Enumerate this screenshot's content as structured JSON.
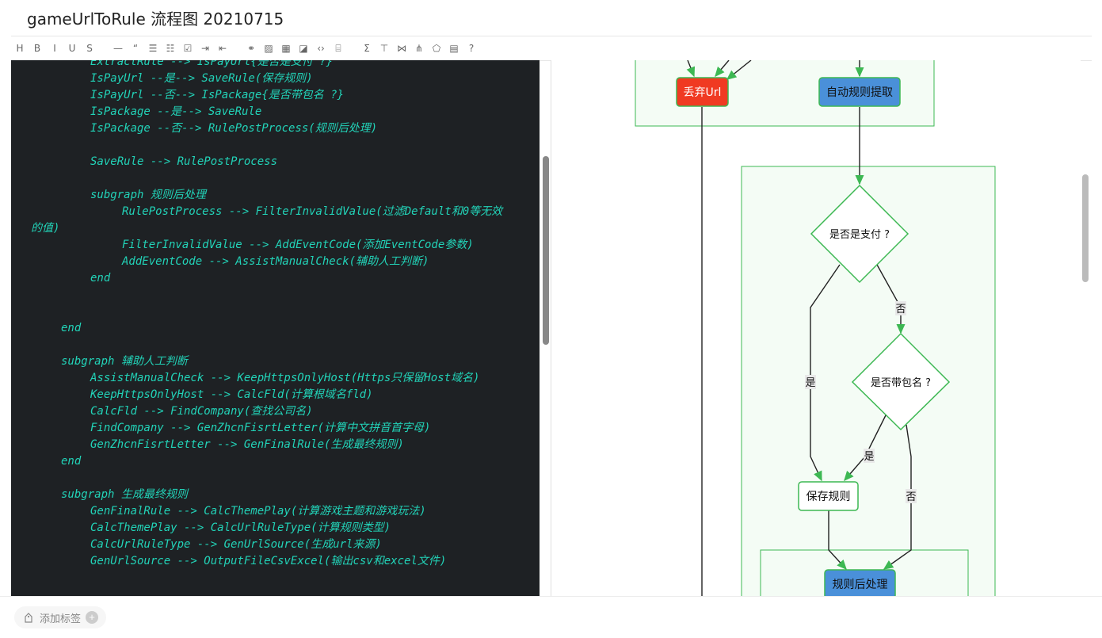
{
  "title": "gameUrlToRule 流程图 20210715",
  "toolbar": [
    {
      "name": "heading-button",
      "glyph": "H"
    },
    {
      "name": "bold-button",
      "glyph": "B"
    },
    {
      "name": "italic-button",
      "glyph": "I"
    },
    {
      "name": "underline-button",
      "glyph": "U"
    },
    {
      "name": "strikethrough-button",
      "glyph": "S"
    },
    {
      "gap": true
    },
    {
      "name": "horizontal-rule-button",
      "glyph": "—"
    },
    {
      "name": "quote-button",
      "glyph": "“"
    },
    {
      "name": "bullet-list-button",
      "glyph": "☰"
    },
    {
      "name": "numbered-list-button",
      "glyph": "☷"
    },
    {
      "name": "checklist-button",
      "glyph": "☑"
    },
    {
      "name": "indent-button",
      "glyph": "⇥"
    },
    {
      "name": "outdent-button",
      "glyph": "⇤"
    },
    {
      "gap": true
    },
    {
      "name": "link-button",
      "glyph": "⚭"
    },
    {
      "name": "image-button",
      "glyph": "▨"
    },
    {
      "name": "table-button",
      "glyph": "▦"
    },
    {
      "name": "chart-button",
      "glyph": "◪"
    },
    {
      "name": "code-button",
      "glyph": "‹›"
    },
    {
      "name": "code-block-button",
      "glyph": "⌸"
    },
    {
      "gap": true
    },
    {
      "name": "formula-button",
      "glyph": "Σ"
    },
    {
      "name": "flowchart-button",
      "glyph": "⊤"
    },
    {
      "name": "sequence-button",
      "glyph": "⋈"
    },
    {
      "name": "gantt-button",
      "glyph": "⋔"
    },
    {
      "name": "mindmap-button",
      "glyph": "⬠"
    },
    {
      "name": "toc-button",
      "glyph": "▤"
    },
    {
      "name": "help-button",
      "glyph": "?"
    }
  ],
  "code_lines": [
    {
      "indent": 100,
      "text": "ExtractRule --> IsPayUrl{是否是支付 ?}"
    },
    {
      "indent": 100,
      "text": "IsPayUrl --是--> SaveRule(保存规则)"
    },
    {
      "indent": 100,
      "text": "IsPayUrl --否--> IsPackage{是否带包名 ?}"
    },
    {
      "indent": 100,
      "text": "IsPackage --是--> SaveRule"
    },
    {
      "indent": 100,
      "text": "IsPackage --否--> RulePostProcess(规则后处理)"
    },
    {
      "indent": 0,
      "text": ""
    },
    {
      "indent": 100,
      "text": "SaveRule --> RulePostProcess"
    },
    {
      "indent": 0,
      "text": ""
    },
    {
      "indent": 100,
      "text": "subgraph 规则后处理"
    },
    {
      "indent": 140,
      "text": "RulePostProcess --> FilterInvalidValue(过滤Default和0等无效"
    },
    {
      "indent": 25,
      "text": "的值)"
    },
    {
      "indent": 140,
      "text": "FilterInvalidValue --> AddEventCode(添加EventCode参数)"
    },
    {
      "indent": 140,
      "text": "AddEventCode --> AssistManualCheck(辅助人工判断)"
    },
    {
      "indent": 100,
      "text": "end"
    },
    {
      "indent": 0,
      "text": ""
    },
    {
      "indent": 0,
      "text": ""
    },
    {
      "indent": 63,
      "text": "end"
    },
    {
      "indent": 0,
      "text": ""
    },
    {
      "indent": 63,
      "text": "subgraph 辅助人工判断"
    },
    {
      "indent": 100,
      "text": "AssistManualCheck --> KeepHttpsOnlyHost(Https只保留Host域名)"
    },
    {
      "indent": 100,
      "text": "KeepHttpsOnlyHost --> CalcFld(计算根域名fld)"
    },
    {
      "indent": 100,
      "text": "CalcFld --> FindCompany(查找公司名)"
    },
    {
      "indent": 100,
      "text": "FindCompany --> GenZhcnFisrtLetter(计算中文拼音首字母)"
    },
    {
      "indent": 100,
      "text": "GenZhcnFisrtLetter --> GenFinalRule(生成最终规则)"
    },
    {
      "indent": 63,
      "text": "end"
    },
    {
      "indent": 0,
      "text": ""
    },
    {
      "indent": 63,
      "text": "subgraph 生成最终规则"
    },
    {
      "indent": 100,
      "text": "GenFinalRule --> CalcThemePlay(计算游戏主题和游戏玩法)"
    },
    {
      "indent": 100,
      "text": "CalcThemePlay --> CalcUrlRuleType(计算规则类型)"
    },
    {
      "indent": 100,
      "text": "CalcUrlRuleType --> GenUrlSource(生成url来源)"
    },
    {
      "indent": 100,
      "text": "GenUrlSource --> OutputFileCsvExcel(输出csv和excel文件)"
    }
  ],
  "flow": {
    "discard_url": "丢弃Url",
    "auto_extract": "自动规则提取",
    "is_pay": "是否是支付 ?",
    "is_package": "是否带包名 ?",
    "save_rule": "保存规则",
    "post_process": "规则后处理",
    "yes": "是",
    "no": "否"
  },
  "colors": {
    "node_green_border": "#3db853",
    "subgraph_fill": "#f4fcf5",
    "discard_fill": "#f03a22",
    "blue_fill": "#4a90d9",
    "code_text": "#22d3b8",
    "editor_bg": "#1e2124"
  },
  "footer": {
    "add_tag": "添加标签"
  }
}
